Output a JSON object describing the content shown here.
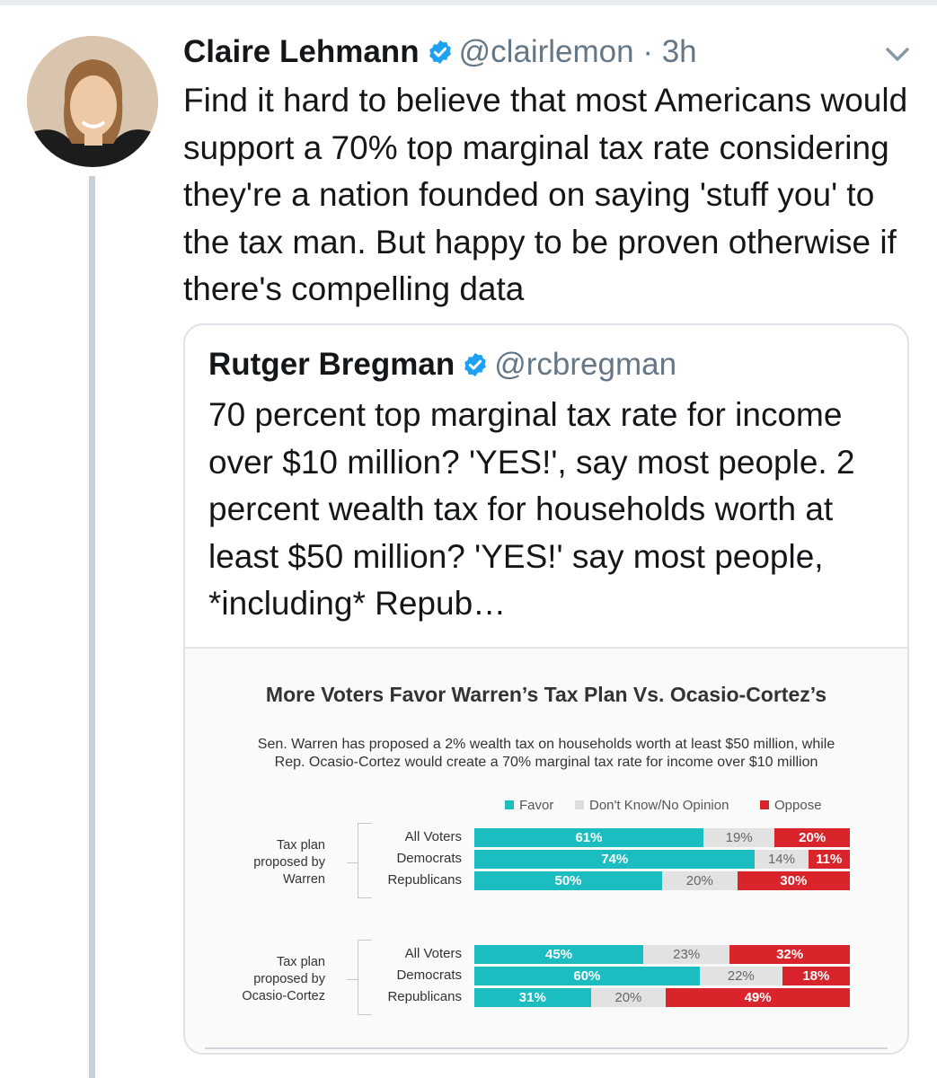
{
  "tweet": {
    "author_name": "Claire Lehmann",
    "handle": "@clairlemon · 3h",
    "text": "Find it hard to believe that most Americans would support a 70% top marginal tax rate considering they're a nation founded on saying 'stuff you' to the tax man. But happy to be proven otherwise if there's compelling data"
  },
  "quote": {
    "author_name": "Rutger Bregman",
    "handle": "@rcbregman",
    "text": "70 percent top marginal tax rate for income over $10 million? 'YES!', say most people. 2 percent wealth tax for households worth at least $50 million? 'YES!' say most people, *including* Repub…"
  },
  "colors": {
    "favor": "#1bbdc0",
    "dont_know": "#e2e2e2",
    "oppose": "#d9242b",
    "verified": "#1da1f2",
    "handle": "#657786"
  },
  "icons": {
    "verified": "verified-badge-icon",
    "menu": "chevron-down-icon"
  },
  "chart_data": {
    "type": "bar",
    "stacked": true,
    "orientation": "horizontal",
    "title": "More Voters Favor Warren’s Tax Plan Vs. Ocasio-Cortez’s",
    "subtitle": [
      "Sen. Warren has proposed a 2% wealth tax on households worth at least $50 million, while",
      "Rep. Ocasio-Cortez would create a 70% marginal tax rate for income over $10 million"
    ],
    "legend_position": "top-right",
    "legend": [
      "Favor",
      "Don't Know/No Opinion",
      "Oppose"
    ],
    "groups": [
      {
        "label": [
          "Tax plan",
          "proposed by",
          "Warren"
        ],
        "rows": [
          {
            "label": "All Voters",
            "favor": 61,
            "dont_know": 19,
            "oppose": 20
          },
          {
            "label": "Democrats",
            "favor": 74,
            "dont_know": 14,
            "oppose": 11
          },
          {
            "label": "Republicans",
            "favor": 50,
            "dont_know": 20,
            "oppose": 30
          }
        ]
      },
      {
        "label": [
          "Tax plan",
          "proposed by",
          "Ocasio-Cortez"
        ],
        "rows": [
          {
            "label": "All Voters",
            "favor": 45,
            "dont_know": 23,
            "oppose": 32
          },
          {
            "label": "Democrats",
            "favor": 60,
            "dont_know": 22,
            "oppose": 18
          },
          {
            "label": "Republicans",
            "favor": 31,
            "dont_know": 20,
            "oppose": 49
          }
        ]
      }
    ]
  }
}
